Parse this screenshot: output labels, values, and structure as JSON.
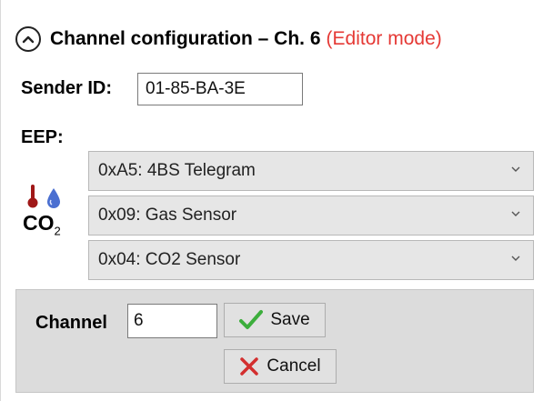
{
  "header": {
    "title": "Channel configuration – Ch. 6",
    "mode": "(Editor mode)"
  },
  "sender": {
    "label": "Sender ID:",
    "value": "01-85-BA-3E"
  },
  "eep": {
    "label": "EEP:",
    "icon_text": "CO",
    "icon_subscript": "2",
    "selects": [
      {
        "value": "0xA5: 4BS Telegram"
      },
      {
        "value": "0x09: Gas Sensor"
      },
      {
        "value": "0x04: CO2 Sensor"
      }
    ]
  },
  "channel": {
    "label": "Channel",
    "value": "6",
    "save_label": "Save",
    "cancel_label": "Cancel"
  },
  "colors": {
    "mode_red": "#e53935",
    "save_green": "#3cae3c",
    "cancel_red": "#d32f2f"
  }
}
